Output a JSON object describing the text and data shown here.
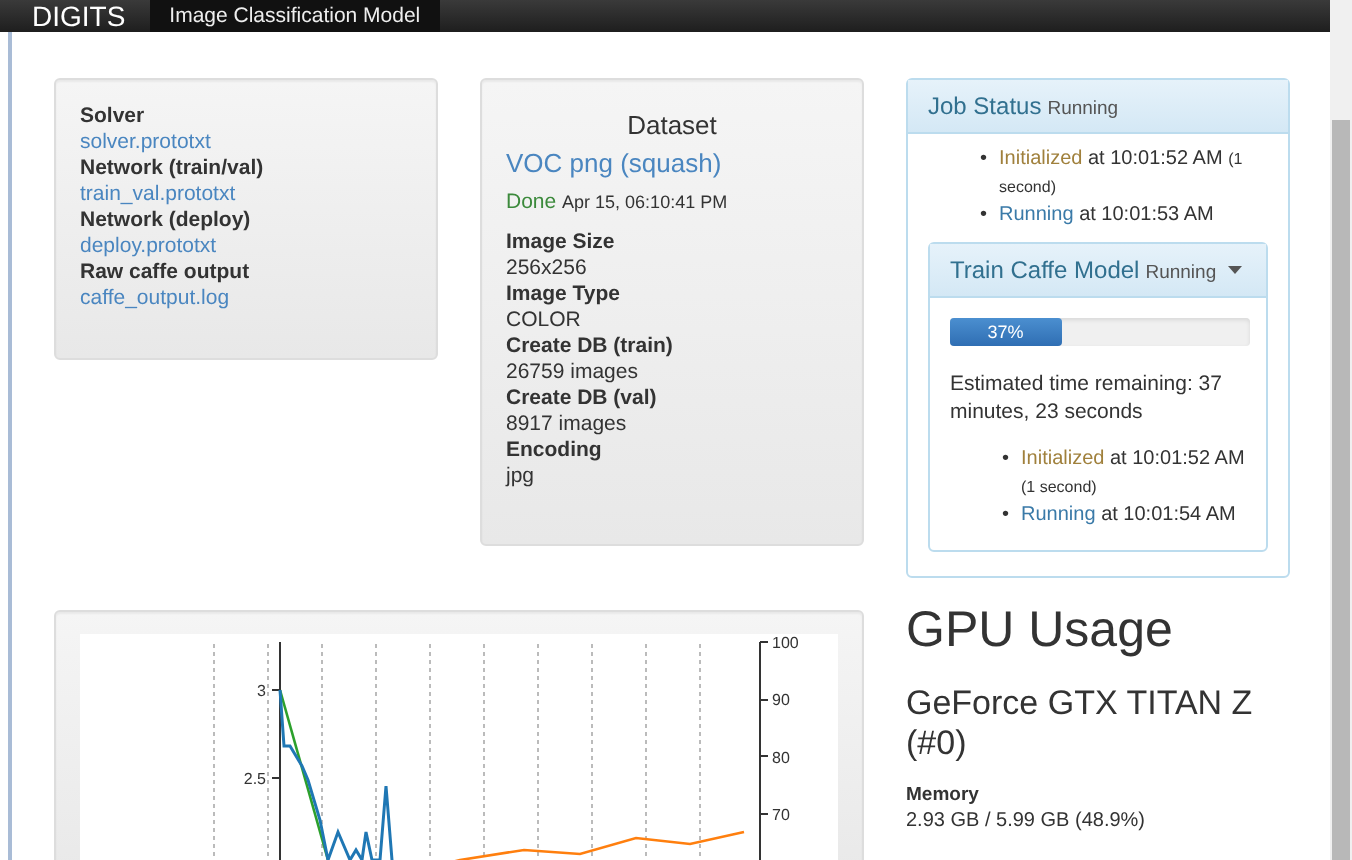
{
  "navbar": {
    "brand": "DIGITS",
    "tabs": [
      {
        "label": "Image Classification Model",
        "selected": true
      }
    ]
  },
  "files_panel": {
    "items": [
      {
        "kind": "heading",
        "text": "Solver"
      },
      {
        "kind": "link",
        "text": "solver.prototxt"
      },
      {
        "kind": "heading",
        "text": "Network (train/val)"
      },
      {
        "kind": "link",
        "text": "train_val.prototxt"
      },
      {
        "kind": "heading",
        "text": "Network (deploy)"
      },
      {
        "kind": "link",
        "text": "deploy.prototxt"
      },
      {
        "kind": "heading",
        "text": "Raw caffe output"
      },
      {
        "kind": "link",
        "text": "caffe_output.log"
      }
    ]
  },
  "dataset_panel": {
    "title": "Dataset",
    "name": "VOC png (squash)",
    "status": "Done",
    "timestamp": "Apr 15, 06:10:41 PM",
    "fields": [
      {
        "label": "Image Size",
        "value": "256x256"
      },
      {
        "label": "Image Type",
        "value": "COLOR"
      },
      {
        "label": "Create DB (train)",
        "value": "26759 images"
      },
      {
        "label": "Create DB (val)",
        "value": "8917 images"
      },
      {
        "label": "Encoding",
        "value": "jpg"
      }
    ]
  },
  "job_status": {
    "title": "Job Status",
    "state": "Running",
    "events": [
      {
        "kind": "initialized",
        "bullet": "•",
        "status": "Initialized",
        "time": "at 10:01:52 AM",
        "duration": "(1 second)"
      },
      {
        "kind": "running",
        "bullet": "•",
        "status": "Running",
        "time": "at 10:01:53 AM"
      }
    ],
    "task": {
      "title": "Train Caffe Model",
      "state": "Running",
      "progress": {
        "level": 0.37,
        "label": "37%"
      },
      "estimate": "Estimated time remaining: 37 minutes, 23 seconds",
      "events": [
        {
          "kind": "initialized",
          "bullet": "•",
          "status": "Initialized",
          "time": "at 10:01:52 AM",
          "duration": "(1 second)"
        },
        {
          "kind": "running",
          "bullet": "•",
          "status": "Running",
          "time": "at 10:01:54 AM"
        }
      ]
    }
  },
  "chart": {
    "left_axis_ticks": [
      "3",
      "2.5"
    ],
    "right_axis_ticks": [
      "100",
      "90",
      "80",
      "70"
    ]
  },
  "gpu": {
    "title": "GPU Usage",
    "device": "GeForce GTX TITAN Z (#0)",
    "stats": [
      {
        "label": "Memory",
        "value": "2.93 GB / 5.99 GB (48.9%)"
      }
    ]
  }
}
